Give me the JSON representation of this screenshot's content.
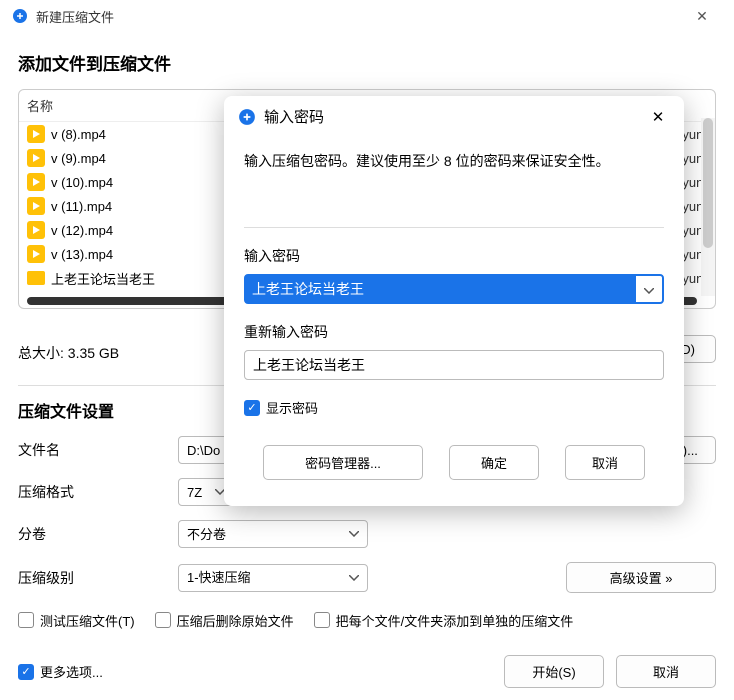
{
  "window": {
    "title": "新建压缩文件"
  },
  "heading": "添加文件到压缩文件",
  "columns": {
    "name": "名称"
  },
  "files": [
    {
      "name": "v (8).mp4",
      "type": "video",
      "path": "yun\\"
    },
    {
      "name": "v (9).mp4",
      "type": "video",
      "path": "yun\\"
    },
    {
      "name": "v (10).mp4",
      "type": "video",
      "path": "yun\\"
    },
    {
      "name": "v (11).mp4",
      "type": "video",
      "path": "yun\\"
    },
    {
      "name": "v (12).mp4",
      "type": "video",
      "path": "yun\\"
    },
    {
      "name": "v (13).mp4",
      "type": "video",
      "path": "yun\\"
    },
    {
      "name": "上老王论坛当老王",
      "type": "folder",
      "path": "yun\\"
    }
  ],
  "total_size": {
    "label": "总大小: ",
    "value": "3.35 GB"
  },
  "buttons": {
    "delete": "(D)",
    "advanced": "高级设置 »",
    "start": "开始(S)",
    "cancel": "取消",
    "browse_suffix": "B)..."
  },
  "settings": {
    "section": "压缩文件设置",
    "filename_label": "文件名",
    "filename_value": "D:\\Do",
    "format_label": "压缩格式",
    "format_value": "7Z",
    "split_label": "分卷",
    "split_value": "不分卷",
    "level_label": "压缩级别",
    "level_value": "1-快速压缩"
  },
  "checkboxes": {
    "test": "测试压缩文件(T)",
    "delete_after": "压缩后删除原始文件",
    "separate": "把每个文件/文件夹添加到单独的压缩文件",
    "more": "更多选项..."
  },
  "pwd_dialog": {
    "title": "输入密码",
    "hint": "输入压缩包密码。建议使用至少 8 位的密码来保证安全性。",
    "label1": "输入密码",
    "value1": "上老王论坛当老王",
    "label2": "重新输入密码",
    "value2": "上老王论坛当老王",
    "show_pwd": "显示密码",
    "btn_manager": "密码管理器...",
    "btn_ok": "确定",
    "btn_cancel": "取消"
  }
}
